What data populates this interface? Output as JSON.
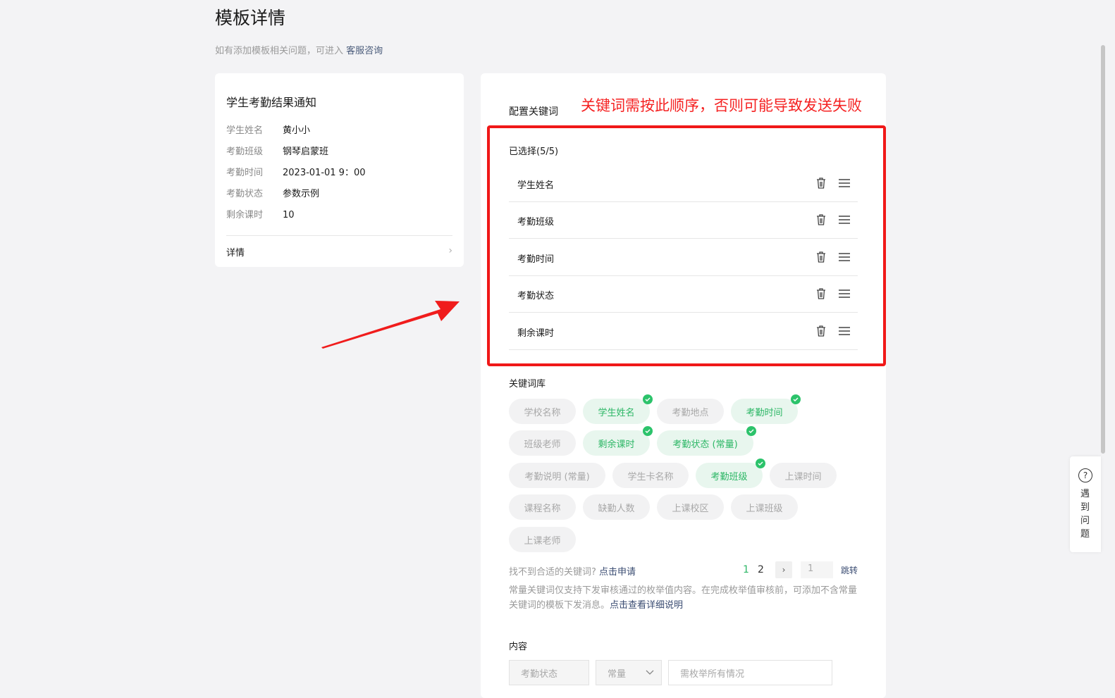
{
  "header": {
    "title": "模板详情",
    "subtitle": "如有添加模板相关问题，可进入",
    "subtitle_link": "客服咨询"
  },
  "preview": {
    "title": "学生考勤结果通知",
    "fields": [
      {
        "label": "学生姓名",
        "value": "黄小小"
      },
      {
        "label": "考勤班级",
        "value": "钢琴启蒙班"
      },
      {
        "label": "考勤时间",
        "value": "2023-01-01 9：00"
      },
      {
        "label": "考勤状态",
        "value": "参数示例"
      },
      {
        "label": "剩余课时",
        "value": "10"
      }
    ],
    "detail_label": "详情"
  },
  "config": {
    "label": "配置关键词",
    "warning": "关键词需按此顺序，否则可能导致发送失败",
    "selected_title": "已选择(5/5)",
    "selected": [
      "学生姓名",
      "考勤班级",
      "考勤时间",
      "考勤状态",
      "剩余课时"
    ],
    "library_title": "关键词库",
    "library": [
      {
        "label": "学校名称",
        "selected": false
      },
      {
        "label": "学生姓名",
        "selected": true
      },
      {
        "label": "考勤地点",
        "selected": false
      },
      {
        "label": "考勤时间",
        "selected": true
      },
      {
        "label": "班级老师",
        "selected": false
      },
      {
        "label": "剩余课时",
        "selected": true
      },
      {
        "label": "考勤状态 (常量)",
        "selected": true
      },
      {
        "label": "考勤说明 (常量)",
        "selected": false
      },
      {
        "label": "学生卡名称",
        "selected": false
      },
      {
        "label": "考勤班级",
        "selected": true
      },
      {
        "label": "上课时间",
        "selected": false
      },
      {
        "label": "课程名称",
        "selected": false
      },
      {
        "label": "缺勤人数",
        "selected": false
      },
      {
        "label": "上课校区",
        "selected": false
      },
      {
        "label": "上课班级",
        "selected": false
      },
      {
        "label": "上课老师",
        "selected": false
      }
    ],
    "cant_find": "找不到合适的关键词?",
    "apply_link": "点击申请",
    "pager": {
      "page1": "1",
      "page2": "2",
      "next": "›",
      "input_value": "1",
      "jump": "跳转"
    },
    "note": "常量关键词仅支持下发审核通过的枚举值内容。在完成枚举值审核前，可添加不含常量关键词的模板下发消息。",
    "note_link": "点击查看详细说明",
    "content_title": "内容",
    "content_field": "考勤状态",
    "content_type": "常量",
    "content_placeholder": "需枚举所有情况"
  },
  "help": {
    "text": "遇到问题"
  },
  "colors": {
    "accent_green": "#2db766",
    "warning_red": "#f52222",
    "link_blue": "#3a4c72"
  }
}
